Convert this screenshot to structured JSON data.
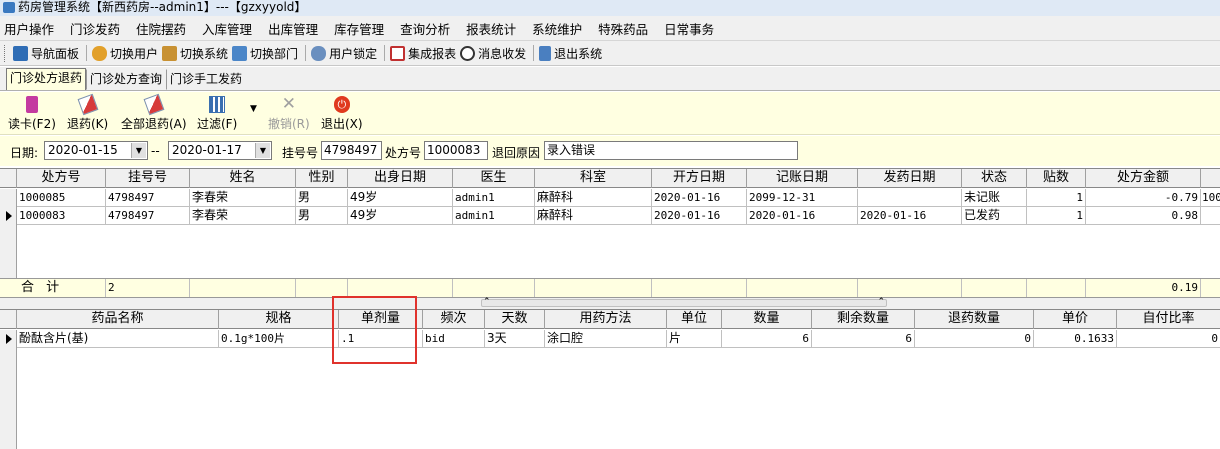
{
  "window": {
    "title": "药房管理系统【新西药房--admin1】---【gzxyyold】"
  },
  "menu": [
    "用户操作",
    "门诊发药",
    "住院摆药",
    "入库管理",
    "出库管理",
    "库存管理",
    "查询分析",
    "报表统计",
    "系统维护",
    "特殊药品",
    "日常事务"
  ],
  "toolbar": {
    "nav": "导航面板",
    "switch_user": "切换用户",
    "switch_system": "切换系统",
    "switch_dept": "切换部门",
    "lock": "用户锁定",
    "report": "集成报表",
    "message": "消息收发",
    "exit": "退出系统"
  },
  "tabs": [
    "门诊处方退药",
    "门诊处方查询",
    "门诊手工发药"
  ],
  "actions": {
    "read_card": "读卡(F2)",
    "return": "退药(K)",
    "return_all": "全部退药(A)",
    "filter": "过滤(F)",
    "cancel": "撤销(R)",
    "exit": "退出(X)"
  },
  "filter": {
    "date_label": "日期:",
    "date_from": "2020-01-15",
    "dash": "--",
    "date_to": "2020-01-17",
    "reg_label": "挂号号",
    "reg_no": "4798497",
    "rx_label": "处方号",
    "rx_no": "1000083",
    "reason_label": "退回原因",
    "reason": "录入错误"
  },
  "rx_grid": {
    "headers": [
      "处方号",
      "挂号号",
      "姓名",
      "性别",
      "出身日期",
      "医生",
      "科室",
      "开方日期",
      "记账日期",
      "发药日期",
      "状态",
      "贴数",
      "处方金额"
    ],
    "rows": [
      [
        "1000085",
        "4798497",
        "李春荣",
        "男",
        "49岁",
        "admin1",
        "麻醉科",
        "2020-01-16",
        "2099-12-31",
        "",
        "未记账",
        "1",
        "-0.79",
        "100"
      ],
      [
        "1000083",
        "4798497",
        "李春荣",
        "男",
        "49岁",
        "admin1",
        "麻醉科",
        "2020-01-16",
        "2020-01-16",
        "2020-01-16",
        "已发药",
        "1",
        "0.98",
        ""
      ]
    ],
    "summary": {
      "label": "合 计",
      "count": "2",
      "amount": "0.19"
    }
  },
  "drug_grid": {
    "headers": [
      "药品名称",
      "规格",
      "单剂量",
      "频次",
      "天数",
      "用药方法",
      "单位",
      "数量",
      "剩余数量",
      "退药数量",
      "单价",
      "自付比率"
    ],
    "rows": [
      [
        "酚酞含片(基)",
        "0.1g*100片",
        ".1",
        "bid",
        "3天",
        "涂口腔",
        "片",
        "6",
        "6",
        "0",
        "0.1633",
        "0"
      ]
    ]
  }
}
